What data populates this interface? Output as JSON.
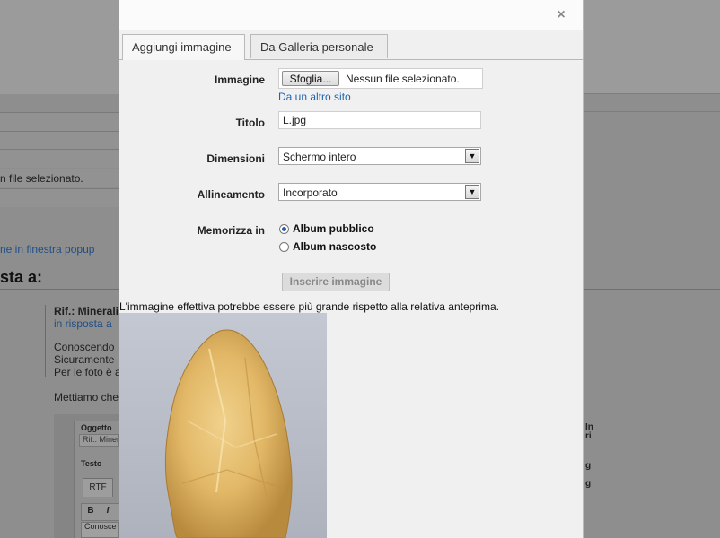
{
  "background": {
    "file_status_fragment": "n file selezionato.",
    "popup_link_fragment": "ne in finestra popup",
    "reply_heading_fragment": "sta a:",
    "post_title_fragment": "Rif.: Minerali",
    "reply_link_fragment": "in risposta a",
    "body_lines": [
      "Conoscendo",
      "Sicuramente",
      "Per le foto è a",
      "Mettiamo che"
    ],
    "editor_subject_label": "Oggetto",
    "editor_subject_value": "Rif.: Miner",
    "editor_text_label": "Testo",
    "editor_tab": "RTF",
    "toolbar_bold": "B",
    "toolbar_italic": "I",
    "editor_body_preview": "Conosce",
    "right_fragments": [
      "In",
      "ri",
      "g",
      "g"
    ]
  },
  "dialog": {
    "close_glyph": "×",
    "tabs": [
      {
        "label": "Aggiungi immagine",
        "active": true
      },
      {
        "label": "Da Galleria personale",
        "active": false
      }
    ],
    "image_label": "Immagine",
    "browse_button": "Sfoglia...",
    "file_status": "Nessun file selezionato.",
    "other_site_link": "Da un altro sito",
    "title_label": "Titolo",
    "title_value": "L.jpg",
    "size_label": "Dimensioni",
    "size_value": "Schermo intero",
    "align_label": "Allineamento",
    "align_value": "Incorporato",
    "store_label": "Memorizza in",
    "store_options": [
      {
        "label": "Album pubblico",
        "checked": true
      },
      {
        "label": "Album nascosto",
        "checked": false
      }
    ],
    "insert_button": "Inserire immagine",
    "preview_note": "L'immagine effettiva potrebbe essere più grande rispetto alla relativa anteprima."
  },
  "colors": {
    "link": "#1f63b0",
    "dialog_bg": "#f0f0f0",
    "overlay": "#8e8e8e",
    "preview_bg": "#b9bdc8",
    "crystal": "#e2b867"
  },
  "icons": {
    "close": "close-icon",
    "dropdown": "chevron-down-icon"
  }
}
